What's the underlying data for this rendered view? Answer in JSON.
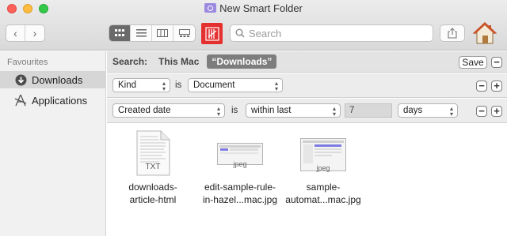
{
  "window": {
    "title": "New Smart Folder"
  },
  "toolbar": {
    "nav_back": "‹",
    "nav_forward": "›",
    "views": [
      "icon-view",
      "list-view",
      "column-view",
      "gallery-view"
    ],
    "search_placeholder": "Search"
  },
  "sidebar": {
    "header": "Favourites",
    "items": [
      {
        "label": "Downloads",
        "icon": "download-icon",
        "selected": true
      },
      {
        "label": "Applications",
        "icon": "applications-icon",
        "selected": false
      }
    ]
  },
  "search_bar": {
    "label": "Search:",
    "scope_this_mac": "This Mac",
    "scope_selected": "“Downloads”",
    "save_label": "Save",
    "minus": "−"
  },
  "rules": [
    {
      "attribute": "Kind",
      "operator": "is",
      "value": "Document"
    },
    {
      "attribute": "Created date",
      "operator": "is",
      "qualifier": "within last",
      "amount": "7",
      "unit": "days"
    }
  ],
  "rule_buttons": {
    "minus": "−",
    "plus": "+"
  },
  "files": [
    {
      "name_line1": "downloads-",
      "name_line2": "article-html",
      "badge": "TXT"
    },
    {
      "name_line1": "edit-sample-rule-",
      "name_line2": "in-hazel...mac.jpg",
      "badge": "jpeg"
    },
    {
      "name_line1": "sample-",
      "name_line2": "automat...mac.jpg",
      "badge": "jpeg"
    }
  ]
}
